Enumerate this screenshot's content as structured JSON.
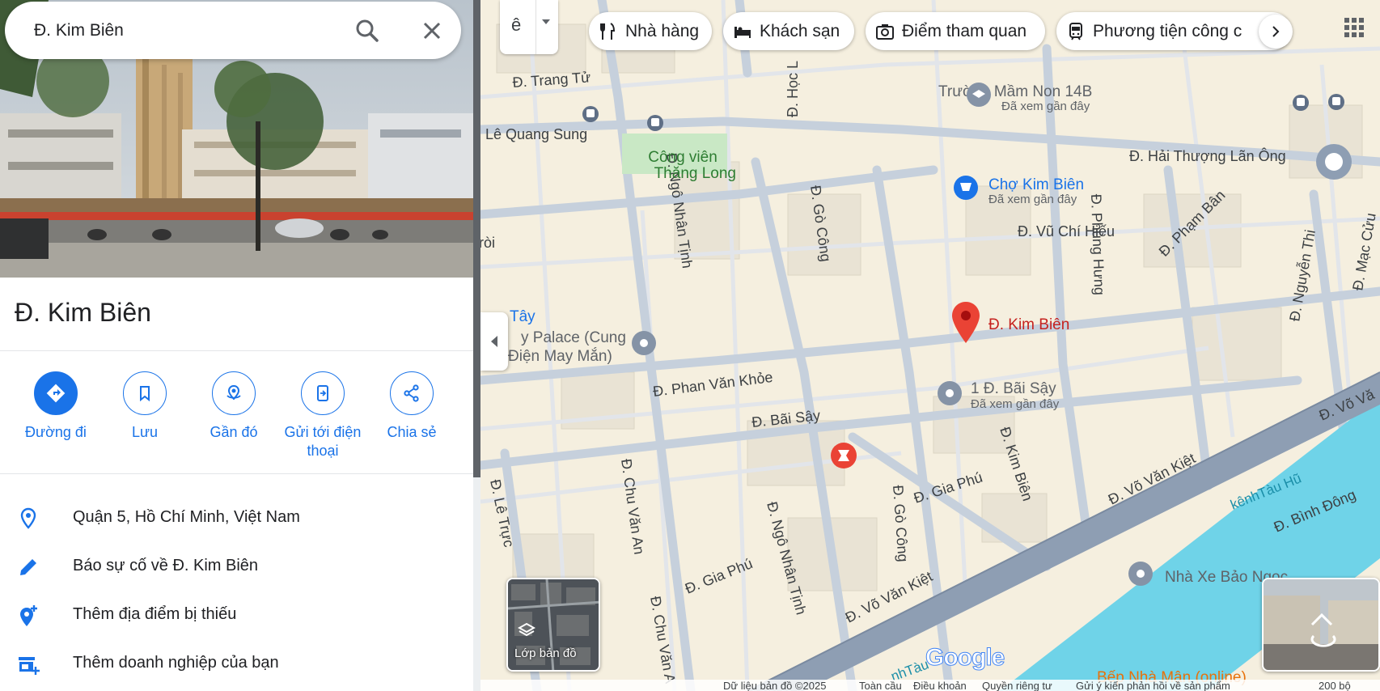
{
  "search": {
    "value": "Đ. Kim Biên"
  },
  "place": {
    "title": "Đ. Kim Biên",
    "actions": [
      {
        "label": "Đường đi"
      },
      {
        "label": "Lưu"
      },
      {
        "label": "Gần đó"
      },
      {
        "label": "Gửi tới điện thoại"
      },
      {
        "label": "Chia sẻ"
      }
    ],
    "info": [
      {
        "text": "Quận 5, Hồ Chí Minh, Việt Nam",
        "icon": "location-pin-icon"
      },
      {
        "text": "Báo sự cố về Đ. Kim Biên",
        "icon": "pencil-icon"
      },
      {
        "text": "Thêm địa điểm bị thiếu",
        "icon": "add-location-icon"
      },
      {
        "text": "Thêm doanh nghiệp của bạn",
        "icon": "add-business-icon"
      }
    ]
  },
  "map": {
    "lang_glyph": "ê",
    "chips": [
      {
        "label": "Nhà hàng",
        "icon": "restaurant-icon"
      },
      {
        "label": "Khách sạn",
        "icon": "hotel-icon"
      },
      {
        "label": "Điểm tham quan",
        "icon": "camera-icon"
      },
      {
        "label": "Phương tiện công c",
        "icon": "transit-icon"
      }
    ],
    "roads": {
      "trang_tu": "Đ. Trang Tử",
      "le_quang_sung": "Lê Quang Sung",
      "hai_thuong_lan_ong": "Đ. Hải Thượng Lãn Ông",
      "hoc_lac": "Đ. Học L",
      "ngo_nhan_tinh": "Đ. Ngô Nhân Tịnh",
      "go_cong": "Đ. Gò Công",
      "phung_hung": "Đ. Phùng Hưng",
      "vu_chi_hieu": "Đ. Vũ Chí Hiếu",
      "pham_ban": "Đ. Phạm Bân",
      "nguyen_thi": "Đ. Nguyễn Thi",
      "mac_cuu": "Đ. Mạc Cửu",
      "phan_van_khoe": "Đ. Phan Văn Khỏe",
      "bai_say": "Đ. Bãi Sậy",
      "kim_bien": "Đ. Kim Biên",
      "gia_phu": "Đ. Gia Phú",
      "go_cong_2": "Đ. Gò Công",
      "chu_van_an": "Đ. Chu Văn An",
      "ngo_nhan_tinh_2": "Đ. Ngô Nhân Tịnh",
      "gia_phu_2": "Đ. Gia Phú",
      "vo_van_kiet": "Đ. Võ Văn Kiệt",
      "vo_van_kiet_2": "Đ. Võ Văn Kiệt",
      "vo_van_kiet_3": "Đ. Võ Vă",
      "le_truc": "Đ. Lê Trực",
      "chu_van_an_2": "Đ. Chu Văn A",
      "binh_dong": "Đ. Bình Đông",
      "roi": "ròi",
      "canal": "kênhTàu Hũ",
      "canal_2": "nhTàu"
    },
    "pois": {
      "truong_mam_non": "Trường Mầm Non 14B",
      "truong_mam_non_sub": "Đã xem gần đây",
      "cong_vien_1": "Công viên",
      "cong_vien_2": "Thăng Long",
      "cho_kim_bien": "Chợ Kim Biên",
      "cho_kim_bien_sub": "Đã xem gần đây",
      "selected": "Đ. Kim Biên",
      "bai_say_addr": "1 Đ. Bãi Sậy",
      "bai_say_sub": "Đã xem gần đây",
      "palace_1": "Tây",
      "palace_2": "y Palace (Cung",
      "palace_3": "Điện May Mắn)",
      "nha_xe": "Nhà Xe Bảo Ngọc",
      "bep": "Bếp Nhà Mận (online)"
    },
    "layer_label": "Lớp bản đồ",
    "logo": "Google",
    "footer": [
      "Dữ liệu bản đồ ©2025",
      "Toàn cầu",
      "Điều khoản",
      "Quyền riêng tư",
      "Gửi ý kiến phản hồi về sản phẩm",
      "200 bộ"
    ]
  },
  "colors": {
    "accent": "#1a73e8",
    "pin": "#ea4335",
    "river": "#5ecfe6",
    "highway": "#8c9bb0"
  }
}
